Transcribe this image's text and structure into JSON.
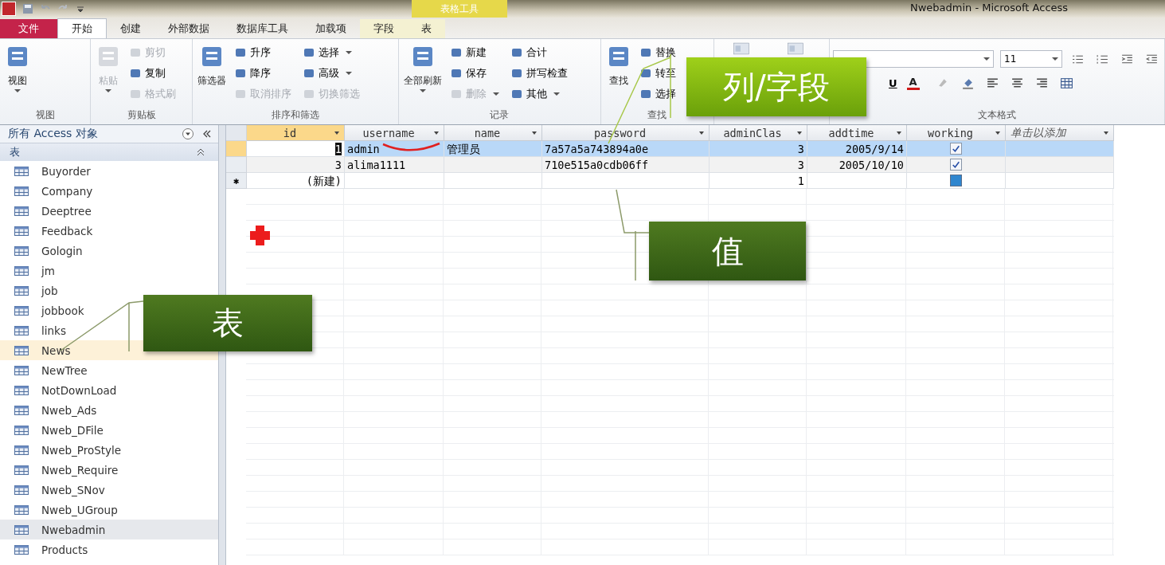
{
  "window": {
    "title": "Nwebadmin  -  Microsoft Access"
  },
  "contextual_tab_group": {
    "label": "表格工具"
  },
  "tabs": [
    {
      "label": "文件",
      "kind": "file",
      "selected": false
    },
    {
      "label": "开始",
      "kind": "normal",
      "selected": true
    },
    {
      "label": "创建",
      "kind": "normal",
      "selected": false
    },
    {
      "label": "外部数据",
      "kind": "normal",
      "selected": false
    },
    {
      "label": "数据库工具",
      "kind": "normal",
      "selected": false
    },
    {
      "label": "加载项",
      "kind": "normal",
      "selected": false
    },
    {
      "label": "字段",
      "kind": "contextual",
      "selected": false
    },
    {
      "label": "表",
      "kind": "contextual",
      "selected": false
    }
  ],
  "ribbon": {
    "groups": [
      {
        "label": "视图",
        "items": [
          {
            "kind": "large",
            "label": "视图",
            "dropdown": true,
            "disabled": false
          }
        ]
      },
      {
        "label": "剪贴板",
        "items": [
          {
            "kind": "large",
            "label": "粘贴",
            "dropdown": true,
            "disabled": true
          },
          {
            "kind": "small",
            "label": "剪切",
            "dropdown": false,
            "disabled": true
          },
          {
            "kind": "small",
            "label": "复制",
            "dropdown": false,
            "disabled": false
          },
          {
            "kind": "small",
            "label": "格式刷",
            "dropdown": false,
            "disabled": true
          }
        ]
      },
      {
        "label": "排序和筛选",
        "items": [
          {
            "kind": "large",
            "label": "筛选器",
            "dropdown": false,
            "disabled": false
          },
          {
            "kind": "small",
            "label": "升序",
            "dropdown": false,
            "disabled": false
          },
          {
            "kind": "small",
            "label": "降序",
            "dropdown": false,
            "disabled": false
          },
          {
            "kind": "small",
            "label": "取消排序",
            "dropdown": false,
            "disabled": true
          },
          {
            "kind": "small",
            "label": "选择",
            "dropdown": true,
            "disabled": false
          },
          {
            "kind": "small",
            "label": "高级",
            "dropdown": true,
            "disabled": false
          },
          {
            "kind": "small",
            "label": "切换筛选",
            "dropdown": false,
            "disabled": true
          }
        ]
      },
      {
        "label": "记录",
        "items": [
          {
            "kind": "large",
            "label": "全部刷新",
            "dropdown": true,
            "disabled": false
          },
          {
            "kind": "small",
            "label": "新建",
            "dropdown": false,
            "disabled": false
          },
          {
            "kind": "small",
            "label": "保存",
            "dropdown": false,
            "disabled": false
          },
          {
            "kind": "small",
            "label": "删除",
            "dropdown": true,
            "disabled": true
          },
          {
            "kind": "small",
            "label": "合计",
            "dropdown": false,
            "disabled": false
          },
          {
            "kind": "small",
            "label": "拼写检查",
            "dropdown": false,
            "disabled": false
          },
          {
            "kind": "small",
            "label": "其他",
            "dropdown": true,
            "disabled": false
          }
        ]
      },
      {
        "label": "查找",
        "items": [
          {
            "kind": "large",
            "label": "查找",
            "dropdown": false,
            "disabled": false
          },
          {
            "kind": "small",
            "label": "替换",
            "dropdown": false,
            "disabled": false
          },
          {
            "kind": "small",
            "label": "转至",
            "dropdown": false,
            "disabled": false
          },
          {
            "kind": "small",
            "label": "选择",
            "dropdown": false,
            "disabled": false
          }
        ]
      },
      {
        "kind": "window",
        "items": [
          {
            "kind": "icon"
          },
          {
            "kind": "icon"
          }
        ]
      },
      {
        "label": "文本格式",
        "kind": "text-format",
        "font_size": "11",
        "underline": "U",
        "font_color": "A"
      }
    ]
  },
  "navigation": {
    "title": "所有 Access 对象",
    "group": "表",
    "items": [
      {
        "label": "Buyorder",
        "selected": false,
        "hovered": false
      },
      {
        "label": "Company",
        "selected": false,
        "hovered": false
      },
      {
        "label": "Deeptree",
        "selected": false,
        "hovered": false
      },
      {
        "label": "Feedback",
        "selected": false,
        "hovered": false
      },
      {
        "label": "Gologin",
        "selected": false,
        "hovered": false
      },
      {
        "label": "jm",
        "selected": false,
        "hovered": false
      },
      {
        "label": "job",
        "selected": false,
        "hovered": false
      },
      {
        "label": "jobbook",
        "selected": false,
        "hovered": false
      },
      {
        "label": "links",
        "selected": false,
        "hovered": false
      },
      {
        "label": "News",
        "selected": false,
        "hovered": true
      },
      {
        "label": "NewTree",
        "selected": false,
        "hovered": false
      },
      {
        "label": "NotDownLoad",
        "selected": false,
        "hovered": false
      },
      {
        "label": "Nweb_Ads",
        "selected": false,
        "hovered": false
      },
      {
        "label": "Nweb_DFile",
        "selected": false,
        "hovered": false
      },
      {
        "label": "Nweb_ProStyle",
        "selected": false,
        "hovered": false
      },
      {
        "label": "Nweb_Require",
        "selected": false,
        "hovered": false
      },
      {
        "label": "Nweb_SNov",
        "selected": false,
        "hovered": false
      },
      {
        "label": "Nweb_UGroup",
        "selected": false,
        "hovered": false
      },
      {
        "label": "Nwebadmin",
        "selected": true,
        "hovered": false
      },
      {
        "label": "Products",
        "selected": false,
        "hovered": false
      }
    ]
  },
  "table": {
    "columns": [
      {
        "label": "id",
        "kind": "number",
        "selected": true
      },
      {
        "label": "username",
        "kind": "text",
        "selected": false
      },
      {
        "label": "name",
        "kind": "text",
        "selected": false
      },
      {
        "label": "password",
        "kind": "text",
        "selected": false
      },
      {
        "label": "adminClas",
        "kind": "number",
        "selected": false
      },
      {
        "label": "addtime",
        "kind": "number",
        "selected": false
      },
      {
        "label": "working",
        "kind": "checkbox",
        "selected": false
      },
      {
        "label": "单击以添加",
        "kind": "add",
        "selected": false
      }
    ],
    "rows": [
      {
        "selected": true,
        "current": true,
        "cells": [
          {
            "value": "1",
            "editing": true
          },
          {
            "value": "admin"
          },
          {
            "value": "管理员"
          },
          {
            "value": "7a57a5a743894a0e"
          },
          {
            "value": "3"
          },
          {
            "value": "2005/9/14"
          },
          {
            "checked": true
          },
          {}
        ]
      },
      {
        "selected": false,
        "current": false,
        "cells": [
          {
            "value": "3"
          },
          {
            "value": "alima1111"
          },
          {},
          {
            "value": "710e515a0cdb06ff"
          },
          {
            "value": "3"
          },
          {
            "value": "2005/10/10"
          },
          {
            "checked": true
          },
          {}
        ]
      },
      {
        "selected": false,
        "current": false,
        "marker": "✱",
        "cells": [
          {
            "value": "(新建)"
          },
          {},
          {},
          {},
          {
            "value": "1"
          },
          {},
          {
            "checked": false
          },
          {}
        ]
      }
    ]
  },
  "annotations": [
    {
      "text": "列/字段",
      "kind": "light"
    },
    {
      "text": "值",
      "kind": "dark"
    },
    {
      "text": "表",
      "kind": "dark"
    }
  ]
}
